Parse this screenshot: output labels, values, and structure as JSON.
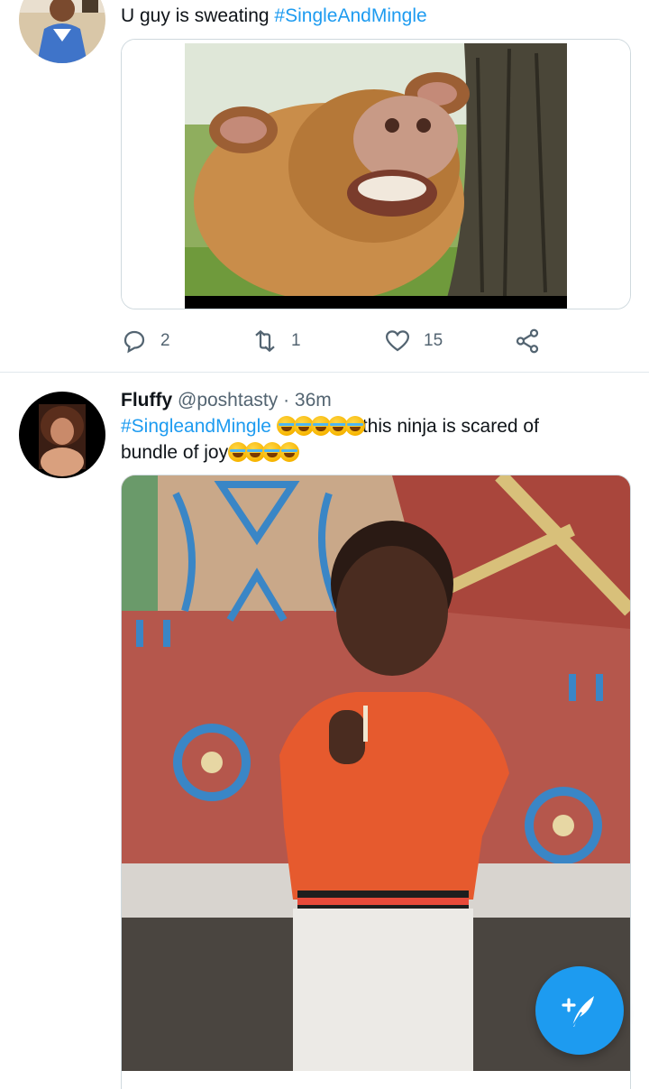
{
  "tweet1": {
    "text_plain": "U guy is sweating ",
    "hashtag": "#SingleAndMingle",
    "image_alt": "cow laughing next to tree"
  },
  "tweet1_actions": {
    "replies": "2",
    "retweets": "1",
    "likes": "15"
  },
  "tweet2": {
    "display_name": "Fluffy",
    "handle": "@poshtasty",
    "separator": "·",
    "time": "36m",
    "hashtag": "#SingleandMingle",
    "text_line1": "this ninja is scared of",
    "text_line2": "bundle of joy",
    "image_alt": "child with lollipop in front of painted wall"
  },
  "icons": {
    "reply": "reply-icon",
    "retweet": "retweet-icon",
    "like": "heart-icon",
    "share": "share-icon",
    "compose": "compose-tweet-icon",
    "more": "more-options-icon",
    "emoji": "rolling-on-floor-laughing-emoji"
  },
  "colors": {
    "accent": "#1d9bf0",
    "secondary_text": "#536471",
    "divider": "#e1e8ed"
  }
}
